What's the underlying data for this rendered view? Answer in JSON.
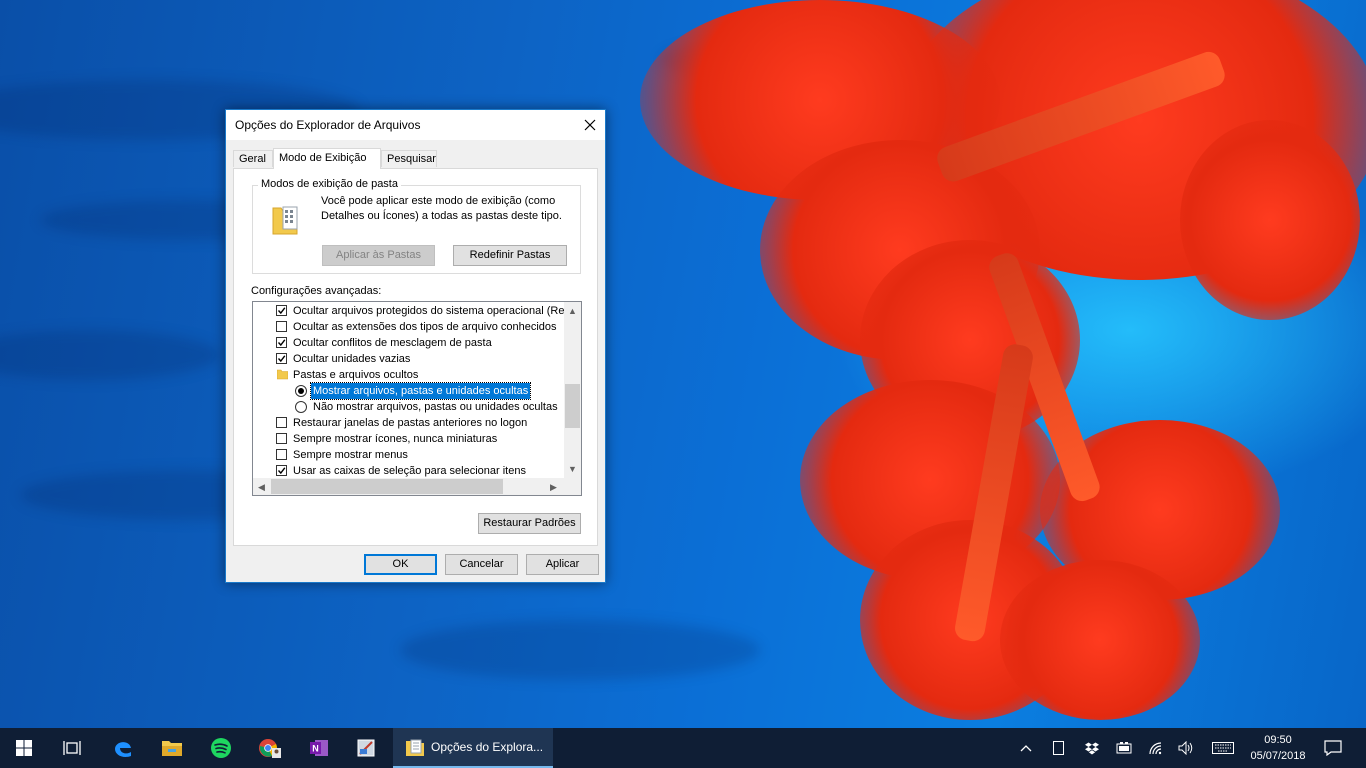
{
  "dialog": {
    "title": "Opções do Explorador de Arquivos",
    "tabs": [
      {
        "label": "Geral",
        "active": false
      },
      {
        "label": "Modo de Exibição",
        "active": true
      },
      {
        "label": "Pesquisar",
        "active": false
      }
    ],
    "folder_views": {
      "group_label": "Modos de exibição de pasta",
      "description": "Você pode aplicar este modo de exibição (como Detalhes ou Ícones) a todas as pastas deste tipo.",
      "apply_button": "Aplicar às Pastas",
      "reset_button": "Redefinir Pastas"
    },
    "advanced": {
      "label": "Configurações avançadas:",
      "items": [
        {
          "type": "checkbox",
          "checked": true,
          "label": "Ocultar arquivos protegidos do sistema operacional (Reco"
        },
        {
          "type": "checkbox",
          "checked": false,
          "label": "Ocultar as extensões dos tipos de arquivo conhecidos"
        },
        {
          "type": "checkbox",
          "checked": true,
          "label": "Ocultar conflitos de mesclagem de pasta"
        },
        {
          "type": "checkbox",
          "checked": true,
          "label": "Ocultar unidades vazias"
        },
        {
          "type": "folder",
          "label": "Pastas e arquivos ocultos"
        },
        {
          "type": "radio",
          "checked": true,
          "selected": true,
          "label": "Mostrar arquivos, pastas e unidades ocultas"
        },
        {
          "type": "radio",
          "checked": false,
          "label": "Não mostrar arquivos, pastas ou unidades ocultas"
        },
        {
          "type": "checkbox",
          "checked": false,
          "label": "Restaurar janelas de pastas anteriores no logon"
        },
        {
          "type": "checkbox",
          "checked": false,
          "label": "Sempre mostrar ícones, nunca miniaturas"
        },
        {
          "type": "checkbox",
          "checked": false,
          "label": "Sempre mostrar menus"
        },
        {
          "type": "checkbox",
          "checked": true,
          "label": "Usar as caixas de seleção para selecionar itens"
        }
      ]
    },
    "restore_defaults_button": "Restaurar Padrões",
    "ok_button": "OK",
    "cancel_button": "Cancelar",
    "apply_button": "Aplicar"
  },
  "taskbar": {
    "active_app_title": "Opções do Explora...",
    "pinned_icons": [
      "windows-start-icon",
      "task-view-icon",
      "edge-icon",
      "file-explorer-icon",
      "spotify-icon",
      "chrome-icon",
      "onenote-icon",
      "snipping-tool-icon"
    ],
    "tray_icons": [
      "chevron-up-icon",
      "tablet-icon",
      "dropbox-icon",
      "battery-icon",
      "wifi-icon",
      "volume-icon",
      "keyboard-icon",
      "notification-icon"
    ],
    "time": "09:50",
    "date": "05/07/2018"
  },
  "colors": {
    "accent": "#0078d7",
    "taskbar": "#0f1e35",
    "coral": "#ff3b1f"
  }
}
